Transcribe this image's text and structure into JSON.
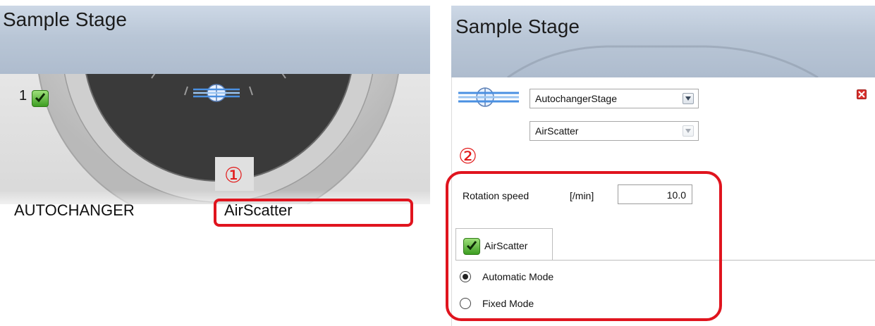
{
  "left_panel": {
    "title": "Sample Stage",
    "position_number": "1",
    "marker": "①",
    "changer_label": "AUTOCHANGER",
    "sample_label": "AirScatter"
  },
  "right_panel": {
    "title": "Sample Stage",
    "stage_select": {
      "value": "AutochangerStage"
    },
    "sample_select": {
      "value": "AirScatter",
      "disabled": true
    },
    "marker": "②",
    "rotation": {
      "label": "Rotation speed",
      "unit": "[/min]",
      "value": "10.0"
    },
    "tab": {
      "label": "AirScatter",
      "checked": true
    },
    "modes": [
      {
        "label": "Automatic Mode",
        "selected": true
      },
      {
        "label": "Fixed Mode",
        "selected": false
      }
    ]
  },
  "colors": {
    "accent_red": "#e0141e",
    "header_blue": "#b9c6d6",
    "check_green": "#3d9d22"
  }
}
